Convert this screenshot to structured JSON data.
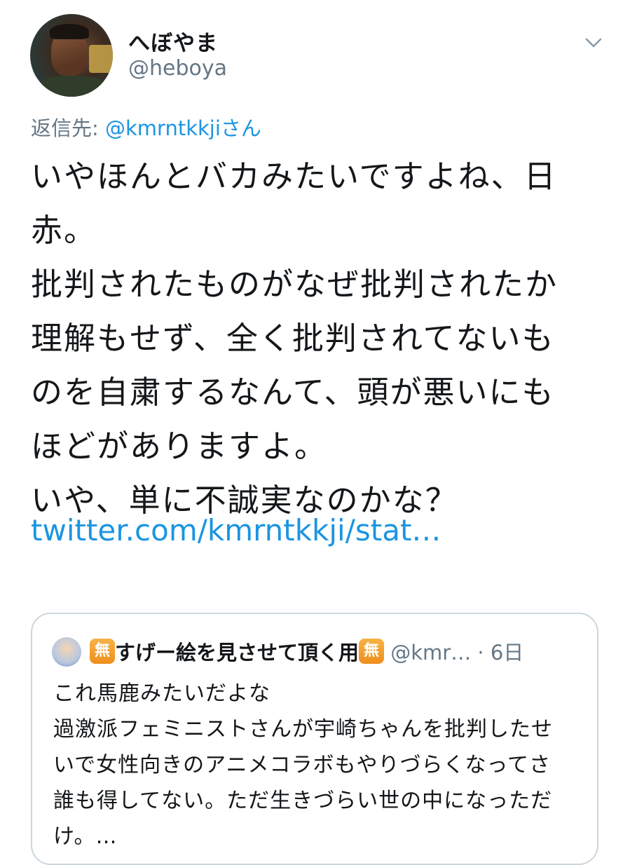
{
  "tweet": {
    "display_name": "へぼやま",
    "handle": "@heboya",
    "avatar_icon": "profile-photo",
    "menu_icon": "chevron-down-icon",
    "reply_prefix": "返信先: ",
    "reply_to": "@kmrntkkjiさん",
    "lines": [
      "いやほんとバカみたいですよね、日",
      "赤。",
      "批判されたものがなぜ批判されたか",
      "理解もせず、全く批判されてないも",
      "のを自粛するなんて、頭が悪いにも",
      "ほどがありますよ。",
      "いや、単に不誠実なのかな？"
    ],
    "link": "twitter.com/kmrntkkji/stat…"
  },
  "quote": {
    "badge": "無",
    "name": "すげー絵を見させて頂く用",
    "handle_time": " @kmr… · 6日",
    "lines": [
      "これ馬鹿みたいだよな",
      "過激派フェミニストさんが宇崎ちゃんを批判したせ",
      "いで女性向きのアニメコラボもやりづらくなってさ",
      "誰も得してない。ただ生きづらい世の中になっただ",
      "け。…"
    ]
  },
  "colors": {
    "text": "#14171a",
    "secondary": "#657786",
    "link": "#1b95e0",
    "border": "#ccd6dd",
    "badge": "#f7b245"
  }
}
